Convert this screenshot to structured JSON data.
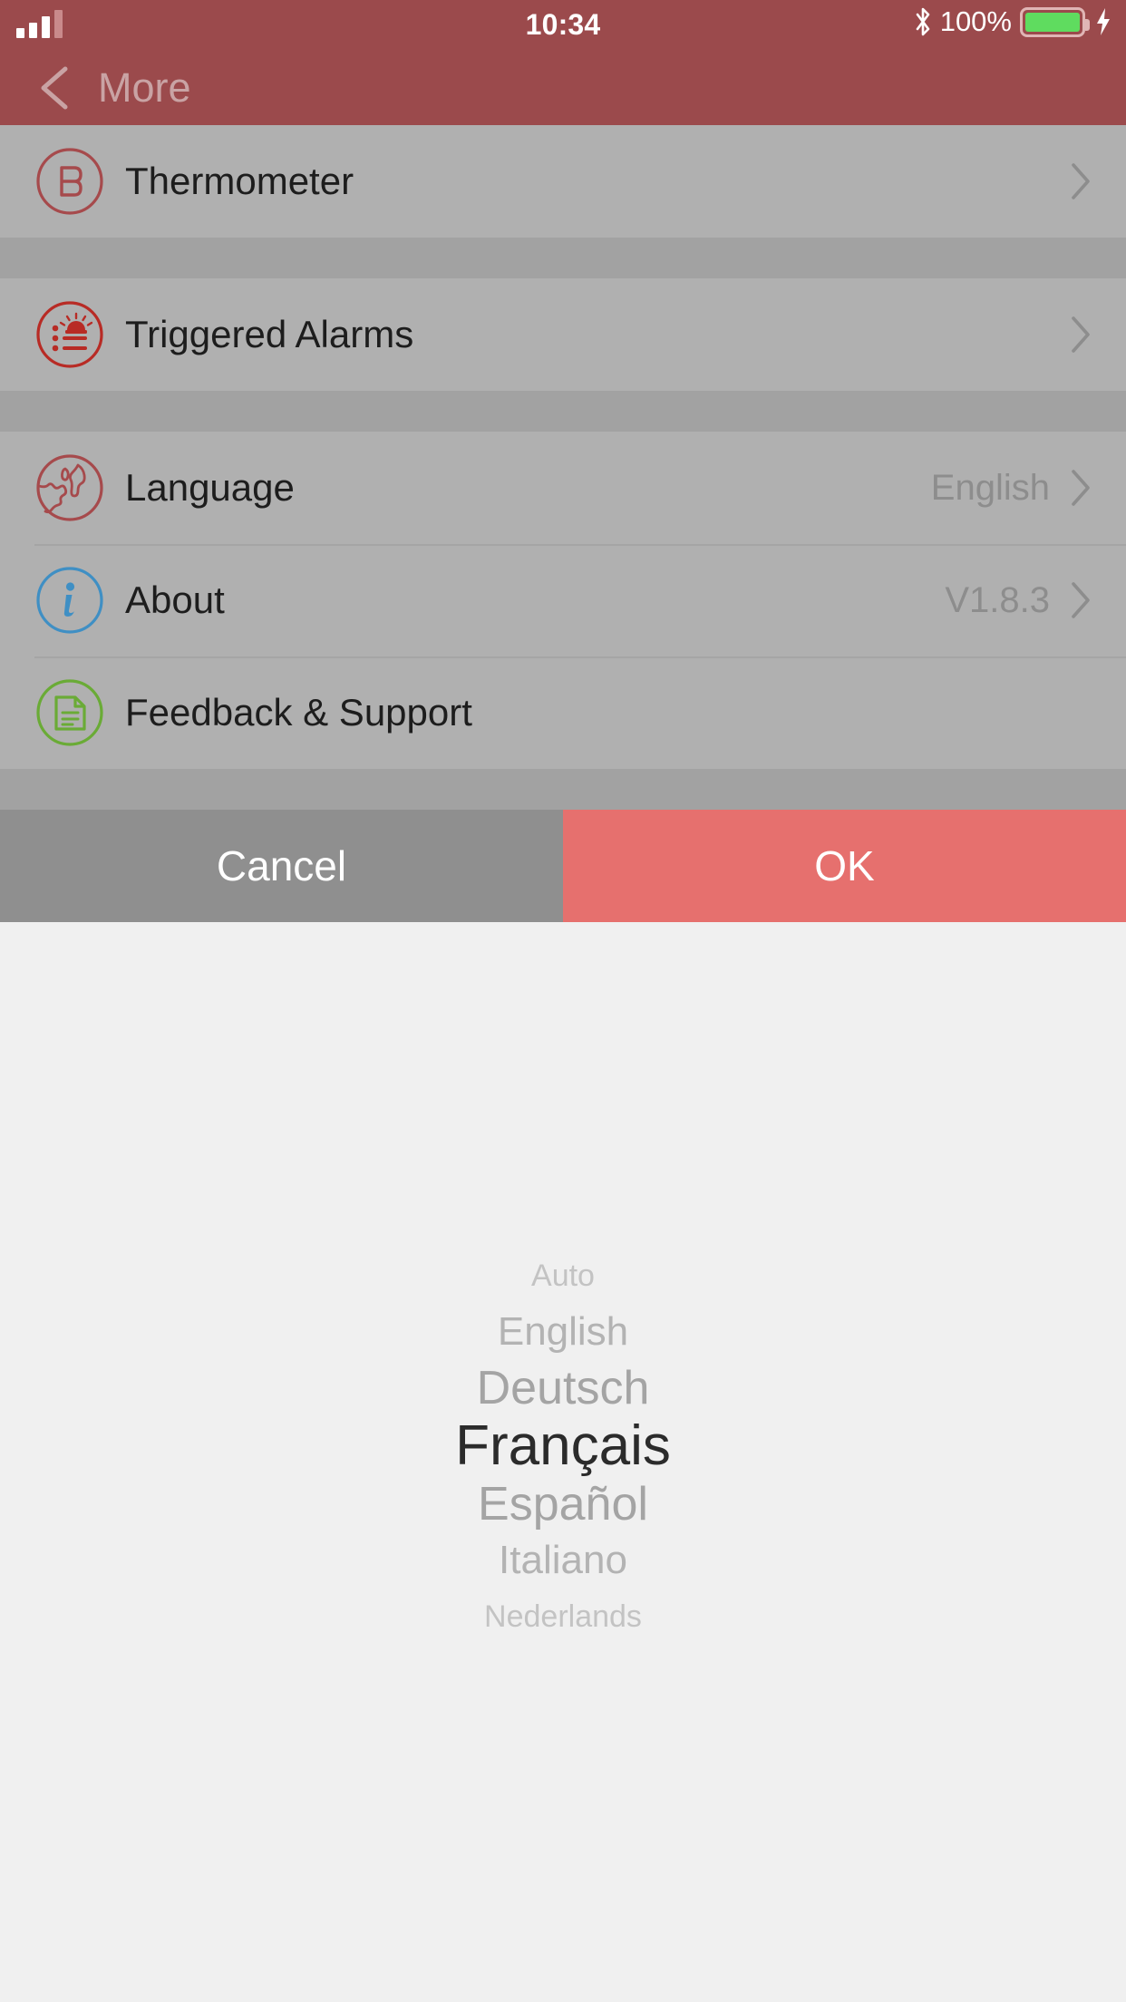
{
  "status_bar": {
    "time": "10:34",
    "battery_percent": "100%",
    "signal_icon": "cellular-signal-icon",
    "bluetooth_icon": "bluetooth-icon",
    "battery_icon": "battery-icon",
    "charging_icon": "lightning-bolt-icon",
    "battery_fill_color": "#5fdc5f"
  },
  "nav": {
    "title": "More",
    "back_icon": "chevron-left-icon",
    "bar_color": "#9b4a4c"
  },
  "list": {
    "groups": [
      {
        "rows": [
          {
            "label": "Thermometer",
            "value": "",
            "icon": "thermometer-icon",
            "icon_color": "#a64a4c",
            "chevron": true
          }
        ]
      },
      {
        "rows": [
          {
            "label": "Triggered Alarms",
            "value": "",
            "icon": "alarm-list-icon",
            "icon_color": "#b82b25",
            "chevron": true
          }
        ]
      },
      {
        "rows": [
          {
            "label": "Language",
            "value": "English",
            "icon": "globe-icon",
            "icon_color": "#a64a4c",
            "chevron": true
          },
          {
            "label": "About",
            "value": "V1.8.3",
            "icon": "info-circle-icon",
            "icon_color": "#3f8fc4",
            "chevron": true
          },
          {
            "label": "Feedback & Support",
            "value": "",
            "icon": "document-icon",
            "icon_color": "#6aab36",
            "chevron": false
          }
        ]
      }
    ]
  },
  "actions": {
    "cancel_label": "Cancel",
    "ok_label": "OK",
    "cancel_color": "#8f8f8f",
    "ok_color": "#e6706e"
  },
  "picker": {
    "selected": "Français",
    "options": [
      {
        "label": "Auto",
        "distance": 3
      },
      {
        "label": "English",
        "distance": 2
      },
      {
        "label": "Deutsch",
        "distance": 1
      },
      {
        "label": "Français",
        "distance": 0
      },
      {
        "label": "Español",
        "distance": 1
      },
      {
        "label": "Italiano",
        "distance": 2
      },
      {
        "label": "Nederlands",
        "distance": 3
      }
    ]
  }
}
